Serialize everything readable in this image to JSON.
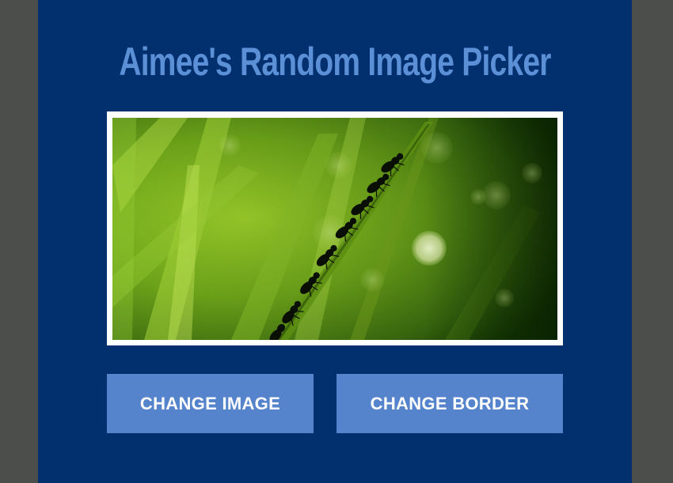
{
  "page": {
    "title": "Aimee's Random Image Picker",
    "background_color": "#4b4e4a",
    "panel_color": "#022f6e",
    "title_color": "#5b8fd6"
  },
  "image": {
    "border_color": "#ffffff",
    "subject": "photo-ants-on-grass-blade"
  },
  "buttons": {
    "change_image_label": "CHANGE IMAGE",
    "change_border_label": "CHANGE BORDER",
    "color": "#5584cc",
    "text_color": "#ffffff"
  }
}
